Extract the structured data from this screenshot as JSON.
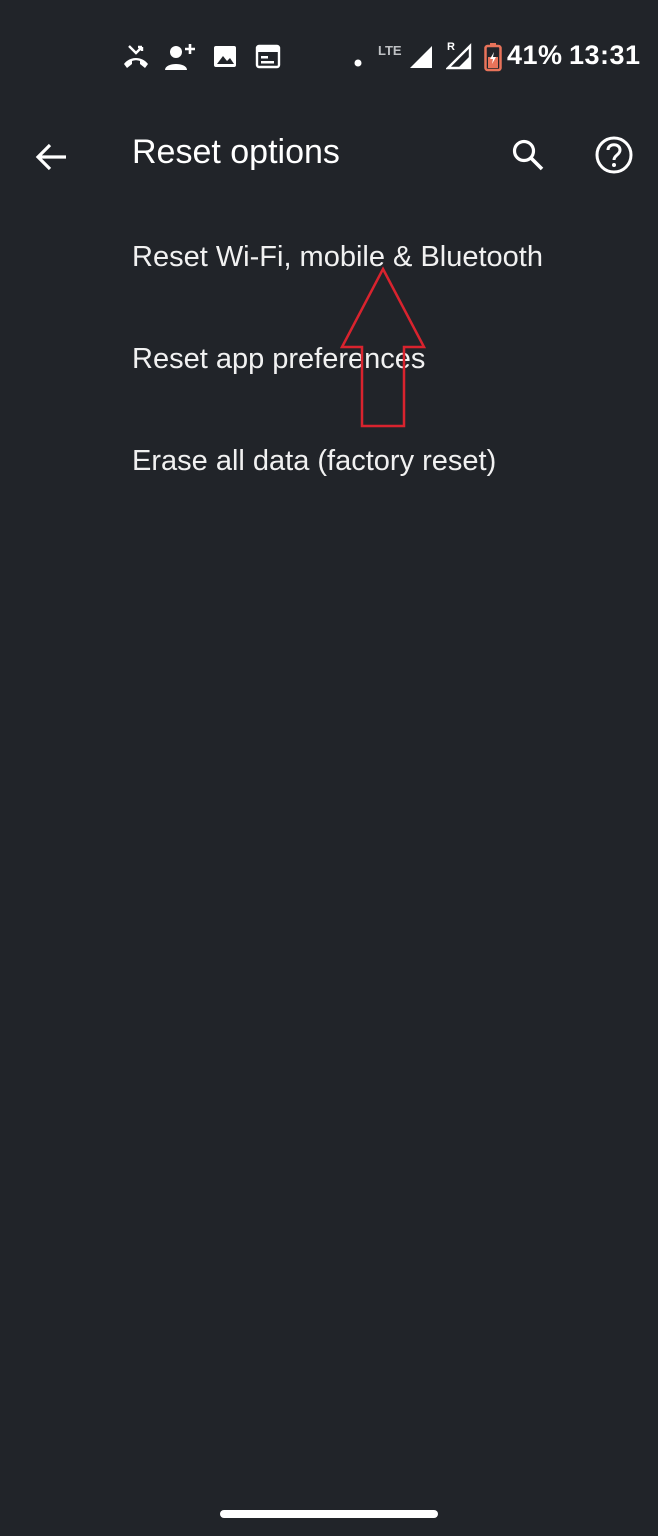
{
  "status_bar": {
    "battery_percent": "41%",
    "time": "13:31",
    "network": "LTE",
    "roaming": "R",
    "icons": [
      "missed-call-icon",
      "add-person-icon",
      "image-icon",
      "calendar-icon",
      "dot-icon",
      "lte-signal-icon",
      "roaming-signal-icon",
      "battery-icon"
    ],
    "battery_color": "#e8735a"
  },
  "app_bar": {
    "title": "Reset options",
    "back_icon": "back-arrow-icon",
    "search_icon": "search-icon",
    "help_icon": "help-icon"
  },
  "reset_options": [
    {
      "label": "Reset Wi-Fi, mobile & Bluetooth"
    },
    {
      "label": "Reset app preferences"
    },
    {
      "label": "Erase all data (factory reset)"
    }
  ],
  "annotation": {
    "type": "arrow-up",
    "color": "#d9232e"
  },
  "theme": {
    "background": "#212429",
    "text": "#ffffff"
  }
}
